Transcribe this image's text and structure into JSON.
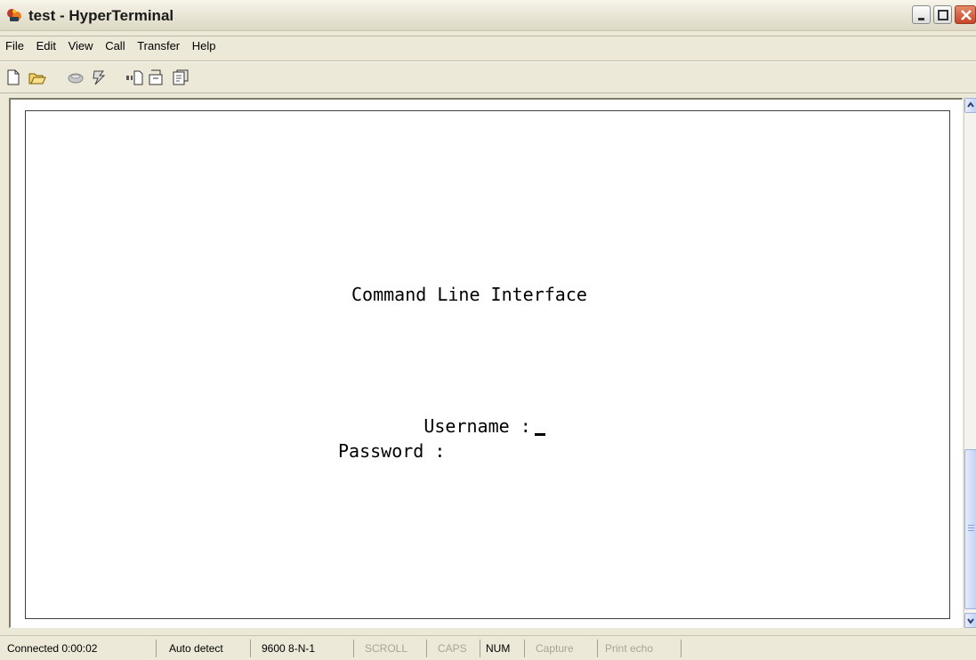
{
  "window": {
    "title": "test - HyperTerminal"
  },
  "menubar": {
    "items": [
      {
        "label": "File"
      },
      {
        "label": "Edit"
      },
      {
        "label": "View"
      },
      {
        "label": "Call"
      },
      {
        "label": "Transfer"
      },
      {
        "label": "Help"
      }
    ]
  },
  "terminal": {
    "heading": "Command Line Interface",
    "username_label": "Username :",
    "password_label": "Password :"
  },
  "statusbar": {
    "connected": "Connected 0:00:02",
    "detect": "Auto detect",
    "port_settings": "9600 8-N-1",
    "scroll": "SCROLL",
    "caps": "CAPS",
    "num": "NUM",
    "capture": "Capture",
    "print_echo": "Print echo"
  },
  "icons": {
    "toolbar": [
      "new-icon",
      "open-icon",
      "disconnect-icon",
      "dial-icon",
      "send-icon",
      "receive-icon",
      "properties-icon"
    ]
  },
  "colors": {
    "close_button": "#c9452a",
    "terminal_bg": "#ffffff",
    "chrome_bg": "#ece9d8"
  }
}
